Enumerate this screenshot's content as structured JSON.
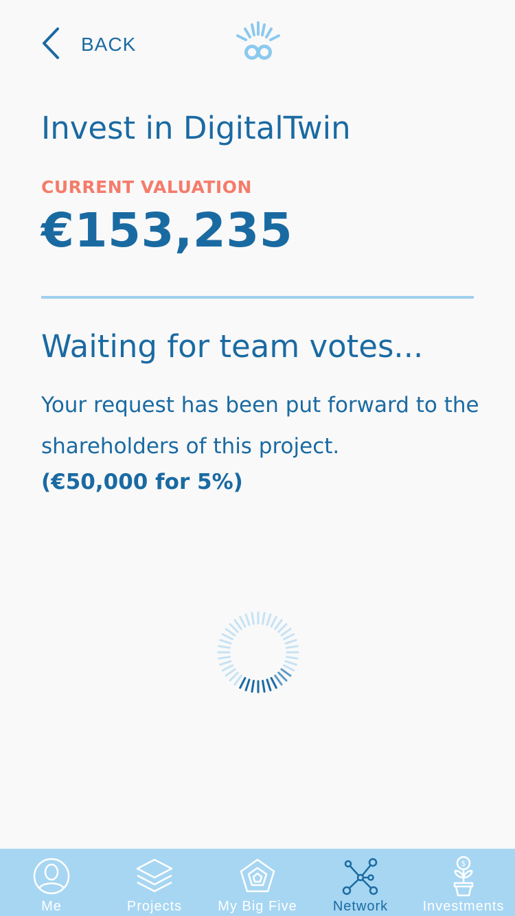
{
  "header": {
    "back_label": "BACK"
  },
  "invest": {
    "title": "Invest in DigitalTwin",
    "valuation_label": "CURRENT VALUATION",
    "valuation_amount": "€153,235"
  },
  "status": {
    "heading": "Waiting for team votes...",
    "message": "Your request has been put forward to the shareholders of this project.",
    "offer": "(€50,000 for 5%)"
  },
  "tabs": [
    {
      "label": "Me",
      "icon": "person-circle-icon",
      "active": false
    },
    {
      "label": "Projects",
      "icon": "layers-icon",
      "active": false
    },
    {
      "label": "My Big Five",
      "icon": "pentagon-icon",
      "active": false
    },
    {
      "label": "Network",
      "icon": "network-icon",
      "active": true
    },
    {
      "label": "Investments",
      "icon": "money-plant-icon",
      "active": false
    }
  ],
  "colors": {
    "primary": "#1a6aa2",
    "accent": "#f47c6a",
    "light_blue": "#9fd0ef",
    "tabbar": "#a7d6f2",
    "background": "#f9f9f9"
  }
}
